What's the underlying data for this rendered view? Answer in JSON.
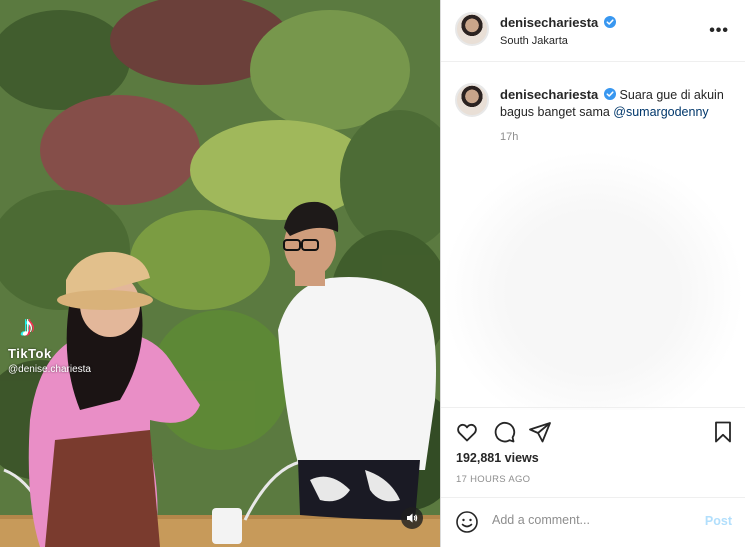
{
  "media": {
    "watermark_brand": "TikTok",
    "watermark_handle": "@denise.chariesta"
  },
  "header": {
    "username": "denisechariesta",
    "location": "South Jakarta",
    "more_icon": "more-horizontal-icon"
  },
  "caption": {
    "username": "denisechariesta",
    "text_before": "Suara gue di akuin bagus banget sama ",
    "mention": "@sumargodenny",
    "time": "17h"
  },
  "actions": {
    "icons": [
      "heart-icon",
      "comment-icon",
      "share-icon",
      "bookmark-icon"
    ],
    "views": "192,881 views",
    "posted_ago": "17 HOURS AGO"
  },
  "comment": {
    "placeholder": "Add a comment...",
    "post_label": "Post",
    "emoji_icon": "emoji-icon"
  },
  "colors": {
    "verified": "#3897f0",
    "mention": "#00376b",
    "post_disabled": "#b2dffc"
  }
}
